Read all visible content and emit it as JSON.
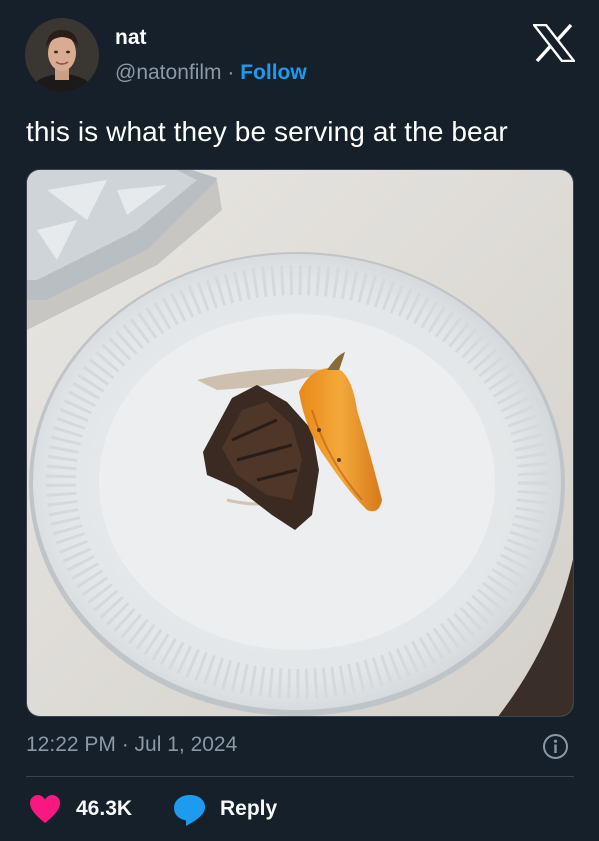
{
  "author": {
    "name": "nat",
    "handle": "@natonfilm",
    "separator": "·",
    "follow_label": "Follow"
  },
  "tweet": {
    "text": "this is what they be serving at the bear",
    "timestamp": "12:22 PM · Jul 1, 2024"
  },
  "engagement": {
    "likes": "46.3K",
    "reply_label": "Reply"
  },
  "colors": {
    "background": "#15202b",
    "accent": "#1d9bf0",
    "like": "#f91880",
    "muted_text": "#8b98a5",
    "divider": "#38444d"
  },
  "icons": [
    "x-logo-icon",
    "info-icon",
    "heart-icon",
    "reply-bubble-icon"
  ]
}
